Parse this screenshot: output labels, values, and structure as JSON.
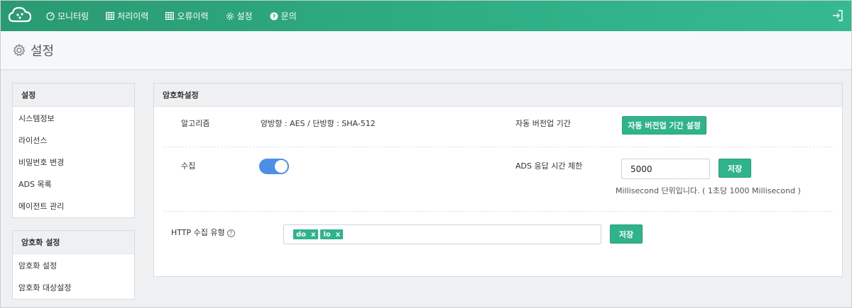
{
  "nav": {
    "items": [
      {
        "label": "모니터링",
        "icon": "dashboard-icon"
      },
      {
        "label": "처리이력",
        "icon": "table-icon"
      },
      {
        "label": "오류이력",
        "icon": "table-icon"
      },
      {
        "label": "설정",
        "icon": "gear-icon"
      },
      {
        "label": "문의",
        "icon": "question-icon"
      }
    ],
    "brand_color": "#2fae84"
  },
  "page": {
    "title": "설정"
  },
  "sidebar": {
    "settings": {
      "header": "설정",
      "items": [
        "시스템정보",
        "라이선스",
        "비밀번호 변경",
        "ADS 목록",
        "에이전트 관리"
      ]
    },
    "encryption": {
      "header": "암호화 설정",
      "items": [
        "암호화 설정",
        "암호화 대상설정"
      ]
    }
  },
  "panel": {
    "title": "암호화설정",
    "algorithm_label": "알고리즘",
    "algorithm_value": "양방향 : AES / 단방향 : SHA-512",
    "auto_version_label": "자동 버전업 기간",
    "auto_version_button": "자동 버전업 기간 설정",
    "collect_label": "수집",
    "collect_enabled": true,
    "ads_timeout_label": "ADS 응답 시간 제한",
    "ads_timeout_value": "5000",
    "ads_timeout_save": "저장",
    "ads_timeout_hint": "Millisecond 단위입니다. ( 1초당 1000 Millisecond )",
    "http_label": "HTTP 수집 유형",
    "http_help": "?",
    "http_tags": [
      "do",
      "lo"
    ],
    "http_save": "저장",
    "tag_remove": "x"
  }
}
